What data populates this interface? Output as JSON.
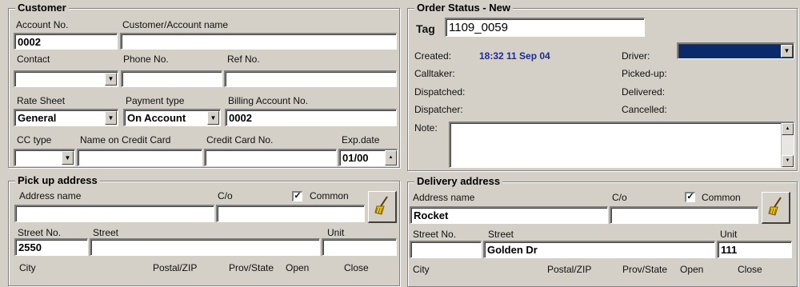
{
  "customer": {
    "title": "Customer",
    "account_no_label": "Account No.",
    "account_no_value": "0002",
    "account_name_label": "Customer/Account name",
    "account_name_value": "",
    "contact_label": "Contact",
    "phone_label": "Phone No.",
    "ref_label": "Ref No.",
    "rate_sheet_label": "Rate Sheet",
    "rate_sheet_value": "General",
    "payment_type_label": "Payment type",
    "payment_type_value": "On Account",
    "billing_label": "Billing Account No.",
    "billing_value": "0002",
    "cc_type_label": "CC type",
    "cc_name_label": "Name on Credit Card",
    "cc_no_label": "Credit Card No.",
    "exp_label": "Exp.date",
    "exp_value": "01/00"
  },
  "order_status": {
    "title": "Order Status - New",
    "tag_label": "Tag",
    "tag_value": "1109_0059",
    "created_label": "Created:",
    "created_value": "18:32 11 Sep 04",
    "calltaker_label": "Calltaker:",
    "dispatched_label": "Dispatched:",
    "dispatcher_label": "Dispatcher:",
    "driver_label": "Driver:",
    "pickedup_label": "Picked-up:",
    "delivered_label": "Delivered:",
    "cancelled_label": "Cancelled:",
    "note_label": "Note:"
  },
  "pickup": {
    "title": "Pick up address",
    "address_name_label": "Address name",
    "co_label": "C/o",
    "common_label": "Common",
    "street_no_label": "Street No.",
    "street_no_value": "2550",
    "street_label": "Street",
    "unit_label": "Unit",
    "city_label": "City",
    "postal_label": "Postal/ZIP",
    "prov_label": "Prov/State",
    "open_label": "Open",
    "close_label": "Close"
  },
  "delivery": {
    "title": "Delivery address",
    "address_name_label": "Address name",
    "address_name_value": "Rocket",
    "co_label": "C/o",
    "common_label": "Common",
    "street_no_label": "Street No.",
    "street_label": "Street",
    "street_value": "Golden Dr",
    "unit_label": "Unit",
    "unit_value": "111",
    "city_label": "City",
    "postal_label": "Postal/ZIP",
    "prov_label": "Prov/State",
    "open_label": "Open",
    "close_label": "Close"
  },
  "icons": {
    "dropdown": "▼",
    "check": "✓",
    "broom": "broom-icon"
  },
  "colors": {
    "driver_select": "#0a2a6a",
    "created_value": "#1a2b9a"
  }
}
